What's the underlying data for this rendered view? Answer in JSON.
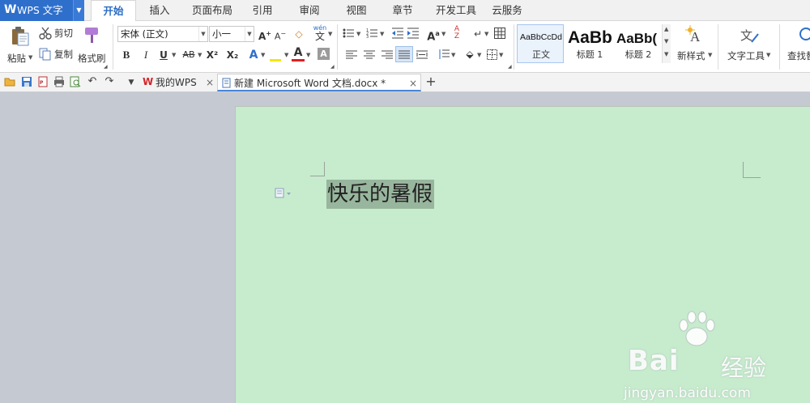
{
  "app": {
    "name": "WPS 文字",
    "logo": "W"
  },
  "menu_tabs": [
    "开始",
    "插入",
    "页面布局",
    "引用",
    "审阅",
    "视图",
    "章节",
    "开发工具",
    "云服务"
  ],
  "active_tab": "开始",
  "ribbon": {
    "clipboard": {
      "paste": "粘贴",
      "cut": "剪切",
      "copy": "复制",
      "format_painter": "格式刷"
    },
    "font": {
      "name": "宋体 (正文)",
      "size": "小一",
      "bold": "B",
      "italic": "I",
      "underline": "U",
      "strike": "AB",
      "superscript": "X²",
      "subscript": "X₂",
      "wen": "wén"
    },
    "styles": [
      {
        "sample": "AaBbCcDd",
        "name": "正文"
      },
      {
        "sample": "AaBb",
        "name": "标题 1"
      },
      {
        "sample": "AaBb(",
        "name": "标题 2"
      }
    ],
    "new_style": "新样式",
    "text_tools": "文字工具",
    "find": "查找替"
  },
  "doc_tabs": [
    {
      "title": "我的WPS",
      "close": "×"
    },
    {
      "title": "新建 Microsoft Word 文档.docx *",
      "close": "×"
    }
  ],
  "new_tab": "+",
  "document": {
    "text": "快乐的暑假"
  },
  "watermark": {
    "brand": "Bai",
    "brand_cn": "经验",
    "url": "jingyan.baidu.com"
  },
  "colors": {
    "accent": "#2e6fcc",
    "page_bg": "#c7ebcd",
    "workspace_bg": "#c5c9d2",
    "selection": "#98b69d"
  }
}
